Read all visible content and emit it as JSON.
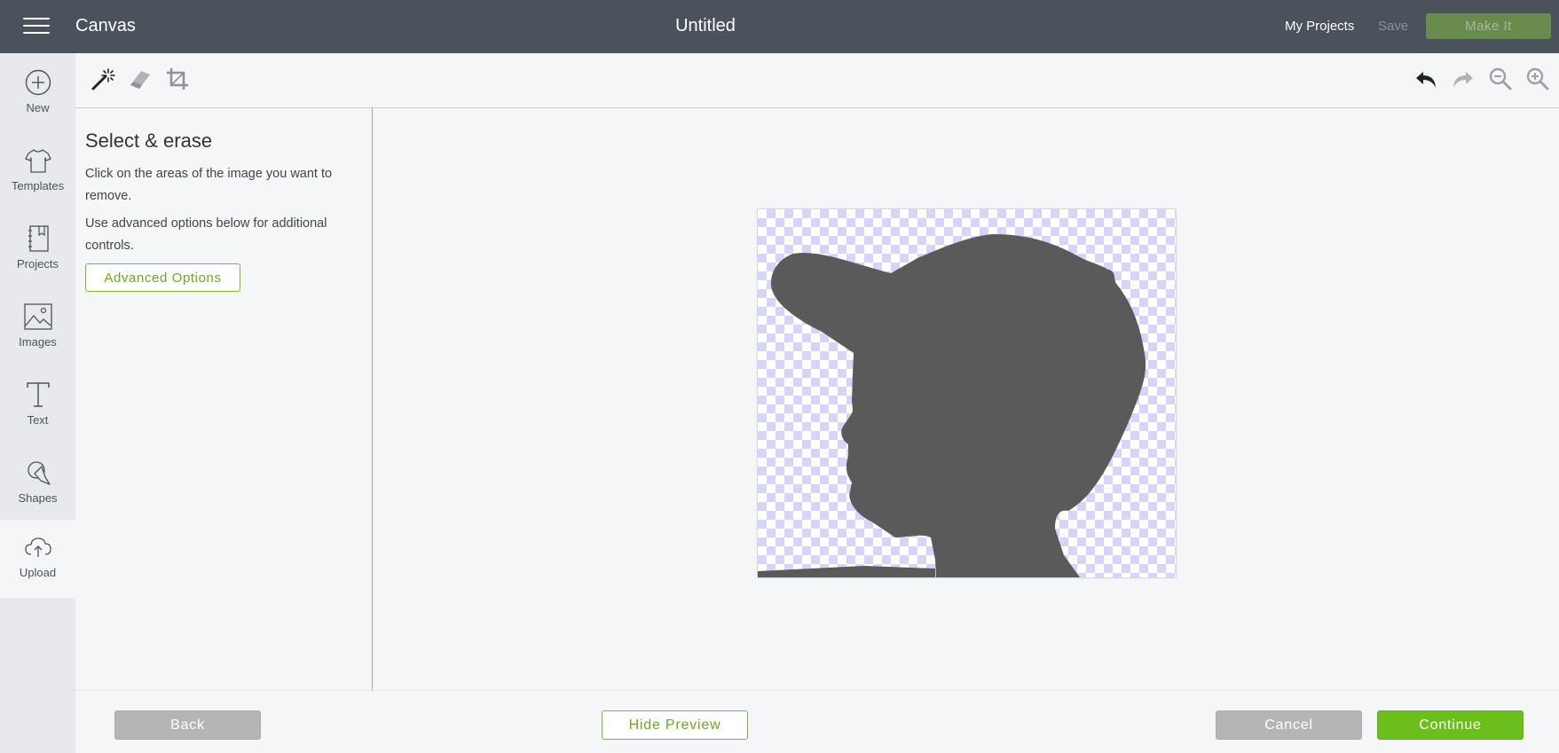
{
  "header": {
    "app_name": "Canvas",
    "doc_title": "Untitled",
    "my_projects": "My Projects",
    "save": "Save",
    "make_it": "Make It"
  },
  "nav": {
    "items": [
      {
        "label": "New",
        "icon": "plus-circle-icon"
      },
      {
        "label": "Templates",
        "icon": "tshirt-icon"
      },
      {
        "label": "Projects",
        "icon": "notebook-icon"
      },
      {
        "label": "Images",
        "icon": "image-icon"
      },
      {
        "label": "Text",
        "icon": "text-t-icon"
      },
      {
        "label": "Shapes",
        "icon": "shapes-icon"
      },
      {
        "label": "Upload",
        "icon": "cloud-upload-icon"
      }
    ],
    "active": "Upload"
  },
  "toolbar": {
    "tools": [
      "magic-wand-icon",
      "eraser-icon",
      "crop-icon"
    ],
    "right_tools": [
      "undo-icon",
      "redo-icon",
      "zoom-out-icon",
      "zoom-in-icon"
    ]
  },
  "panel": {
    "title": "Select & erase",
    "text1": "Click on the areas of the image you want to remove.",
    "text2": "Use advanced options below for additional controls.",
    "advanced_options": "Advanced Options"
  },
  "footer": {
    "back": "Back",
    "hide_preview": "Hide Preview",
    "cancel": "Cancel",
    "continue": "Continue"
  },
  "colors": {
    "header_bg": "#4a535c",
    "accent_green": "#6cbf1a",
    "checker": "#d6d4f8",
    "silhouette": "#5a5a5a"
  }
}
